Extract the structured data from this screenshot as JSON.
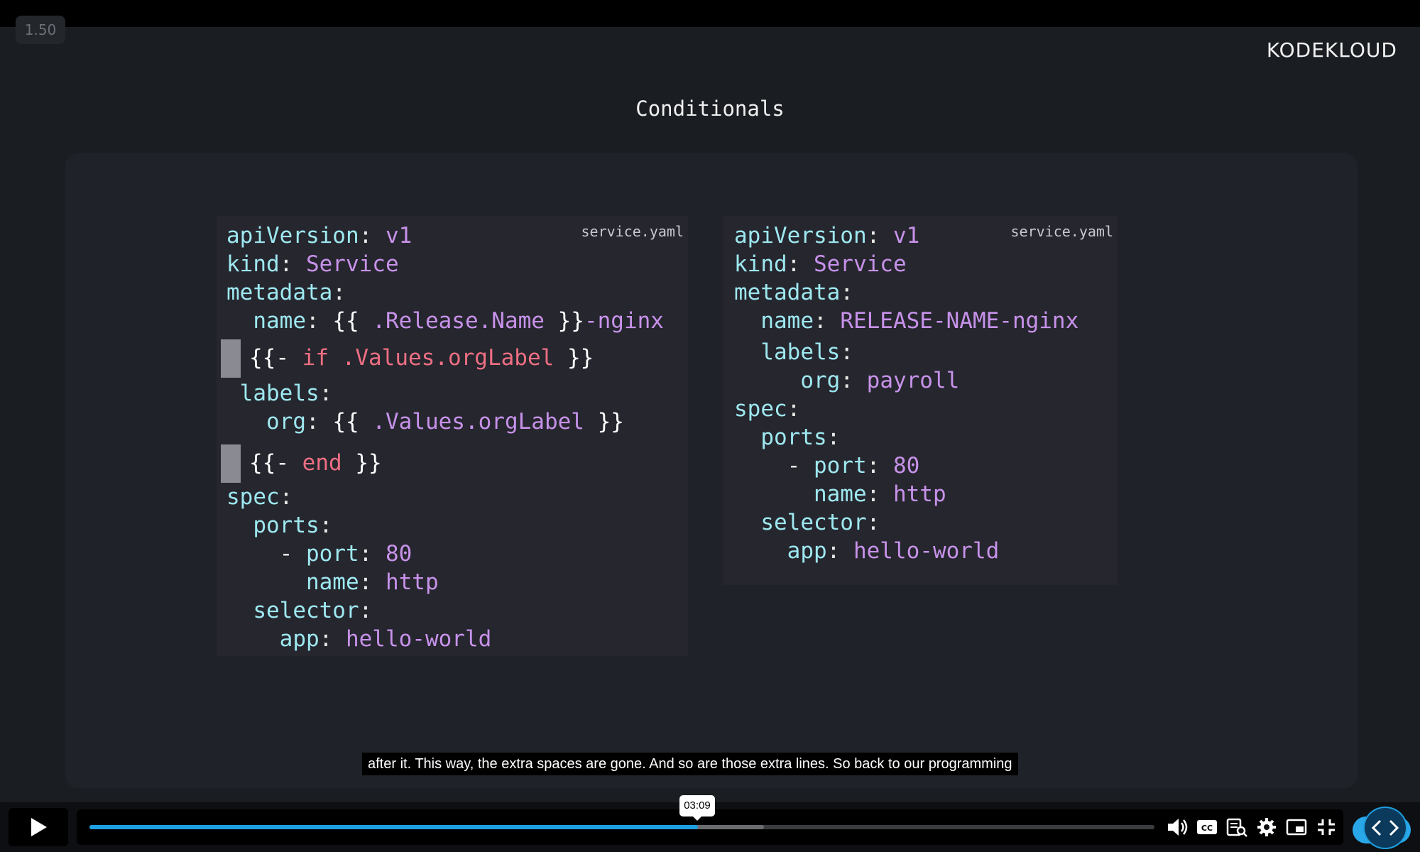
{
  "player": {
    "speed": "1.50",
    "current_time": "03:09",
    "progress_fraction": 0.571,
    "buffered_fraction": 0.633
  },
  "brand": {
    "logo_text": "KODEKLOUD"
  },
  "slide": {
    "title": "Conditionals"
  },
  "left_panel": {
    "filename": "service.yaml",
    "lines": {
      "l1_key": "apiVersion",
      "l1_val": "v1",
      "l2_key": "kind",
      "l2_val": "Service",
      "l3_key": "metadata",
      "l4_key": "name",
      "l4_open": "{{",
      "l4_expr": ".Release.Name",
      "l4_close": "}}",
      "l4_suffix": "-nginx",
      "l5_open": "{{-",
      "l5_kw": "if",
      "l5_expr": ".Values.orgLabel",
      "l5_close": "}}",
      "l6_key": "labels",
      "l7_key": "org",
      "l7_open": "{{",
      "l7_expr": ".Values.orgLabel",
      "l7_close": "}}",
      "l8_open": "{{-",
      "l8_kw": "end",
      "l8_close": "}}",
      "l9_key": "spec",
      "l10_key": "ports",
      "l11_dash": "-",
      "l11_key": "port",
      "l11_val": "80",
      "l12_key": "name",
      "l12_val": "http",
      "l13_key": "selector",
      "l14_key": "app",
      "l14_val": "hello-world"
    }
  },
  "right_panel": {
    "filename": "service.yaml",
    "lines": {
      "l1_key": "apiVersion",
      "l1_val": "v1",
      "l2_key": "kind",
      "l2_val": "Service",
      "l3_key": "metadata",
      "l4_key": "name",
      "l4_val": "RELEASE-NAME-nginx",
      "l5_key": "labels",
      "l6_key": "org",
      "l6_val": "payroll",
      "l7_key": "spec",
      "l8_key": "ports",
      "l9_dash": "-",
      "l9_key": "port",
      "l9_val": "80",
      "l10_key": "name",
      "l10_val": "http",
      "l11_key": "selector",
      "l12_key": "app",
      "l12_val": "hello-world"
    }
  },
  "caption": {
    "text": "after it. This way, the extra spaces are gone. And so are those extra lines. So back to our programming"
  },
  "controls": {
    "icons": [
      "play-icon",
      "volume-icon",
      "closed-captions-icon",
      "transcript-icon",
      "settings-icon",
      "picture-in-picture-icon",
      "exit-fullscreen-icon",
      "code-icon"
    ],
    "accent_color": "#1d9fe0"
  }
}
